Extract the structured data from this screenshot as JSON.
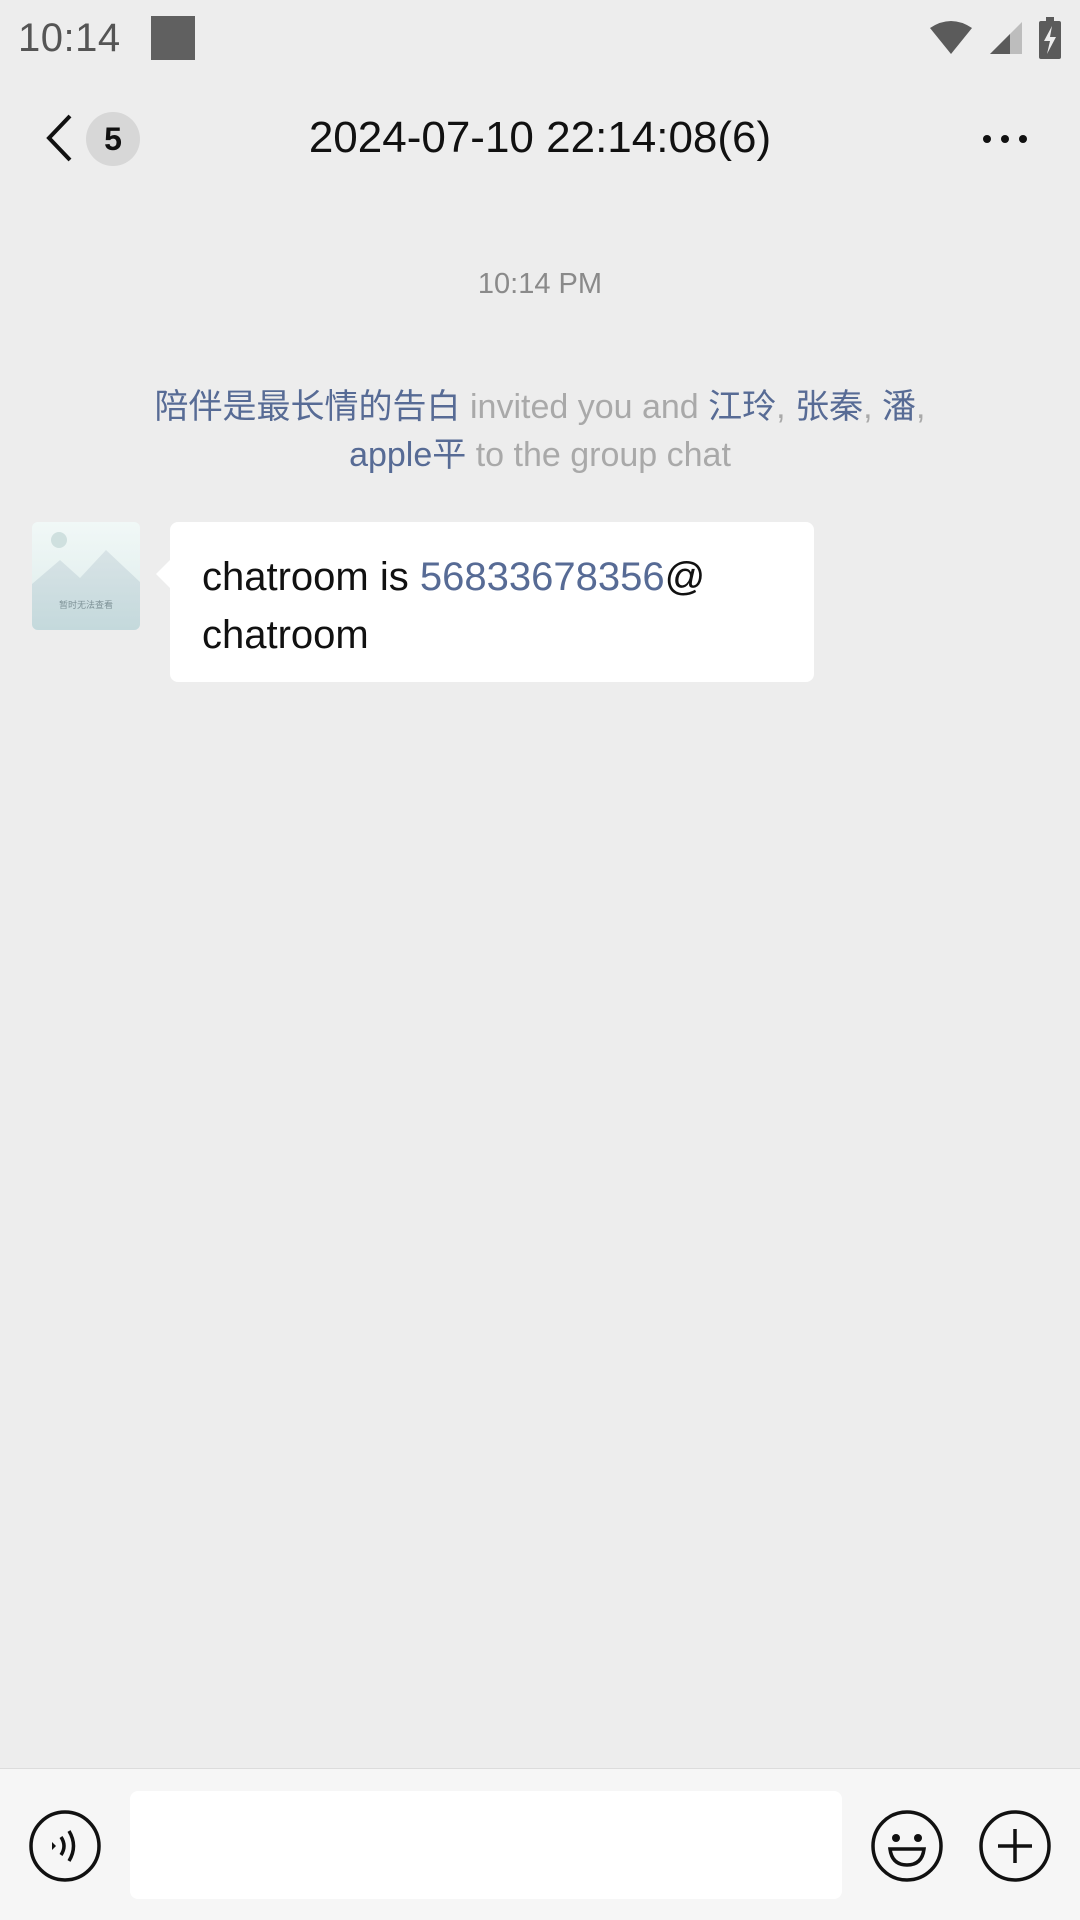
{
  "status_bar": {
    "time": "10:14"
  },
  "header": {
    "unread_count": "5",
    "title": "2024-07-10 22:14:08(6)"
  },
  "messages": {
    "time_divider": "10:14 PM",
    "system": {
      "inviter": "陪伴是最长情的告白",
      "text_invited": " invited you and ",
      "member1": "江玲",
      "sep1": ", ",
      "member2": "张秦",
      "sep2": ", ",
      "member3": "潘",
      "sep3": ", ",
      "member4": "apple平",
      "text_tail": " to the group chat"
    },
    "incoming": {
      "avatar_caption": "暂时无法查看",
      "text_prefix": "chatroom is ",
      "link_number": "56833678356",
      "text_suffix_line1": "@",
      "text_line2": "chatroom"
    }
  },
  "input_bar": {
    "placeholder": ""
  },
  "colors": {
    "background": "#ededed",
    "link": "#576b95",
    "system_text": "#a9a9a9"
  },
  "icons": [
    "wifi-icon",
    "cell-signal-icon",
    "battery-icon",
    "back-chevron-icon",
    "more-icon",
    "voice-icon",
    "emoji-icon",
    "plus-icon"
  ]
}
